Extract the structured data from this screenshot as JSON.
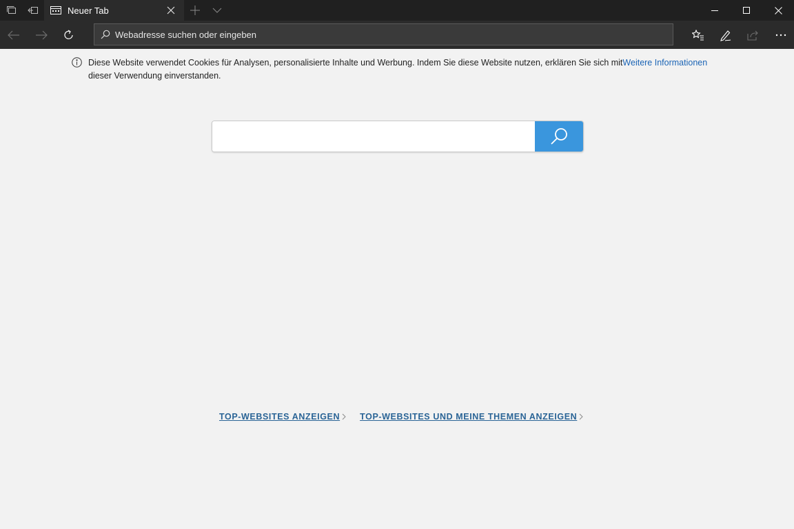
{
  "tab": {
    "title": "Neuer Tab"
  },
  "address": {
    "placeholder": "Webadresse suchen oder eingeben",
    "value": ""
  },
  "cookie": {
    "text": "Diese Website verwendet Cookies für Analysen, personalisierte Inhalte und Werbung. Indem Sie diese Website nutzen, erklären Sie sich mit",
    "link": "Weitere Informationen",
    "text_after": "dieser Verwendung einverstanden."
  },
  "search": {
    "value": ""
  },
  "links": {
    "top_sites": "TOP-WEBSITES ANZEIGEN",
    "top_sites_topics": "TOP-WEBSITES UND MEINE THEMEN ANZEIGEN"
  },
  "icons": {
    "tab_preview": "tab-preview-icon",
    "set_aside": "set-aside-icon",
    "favicon": "new-tab-favicon",
    "close": "close-icon",
    "new_tab": "plus-icon",
    "tab_list": "chevron-down-icon",
    "minimize": "minimize-icon",
    "maximize": "maximize-icon",
    "window_close": "window-close-icon",
    "back": "back-arrow-icon",
    "forward": "forward-arrow-icon",
    "refresh": "refresh-icon",
    "search": "search-icon",
    "favorites": "favorites-icon",
    "ink": "pen-icon",
    "share": "share-icon",
    "more": "more-icon",
    "info": "info-icon"
  },
  "colors": {
    "titlebar": "#202020",
    "navbar": "#2b2b2b",
    "accent": "#3a96dd",
    "link": "#1b64b5"
  }
}
